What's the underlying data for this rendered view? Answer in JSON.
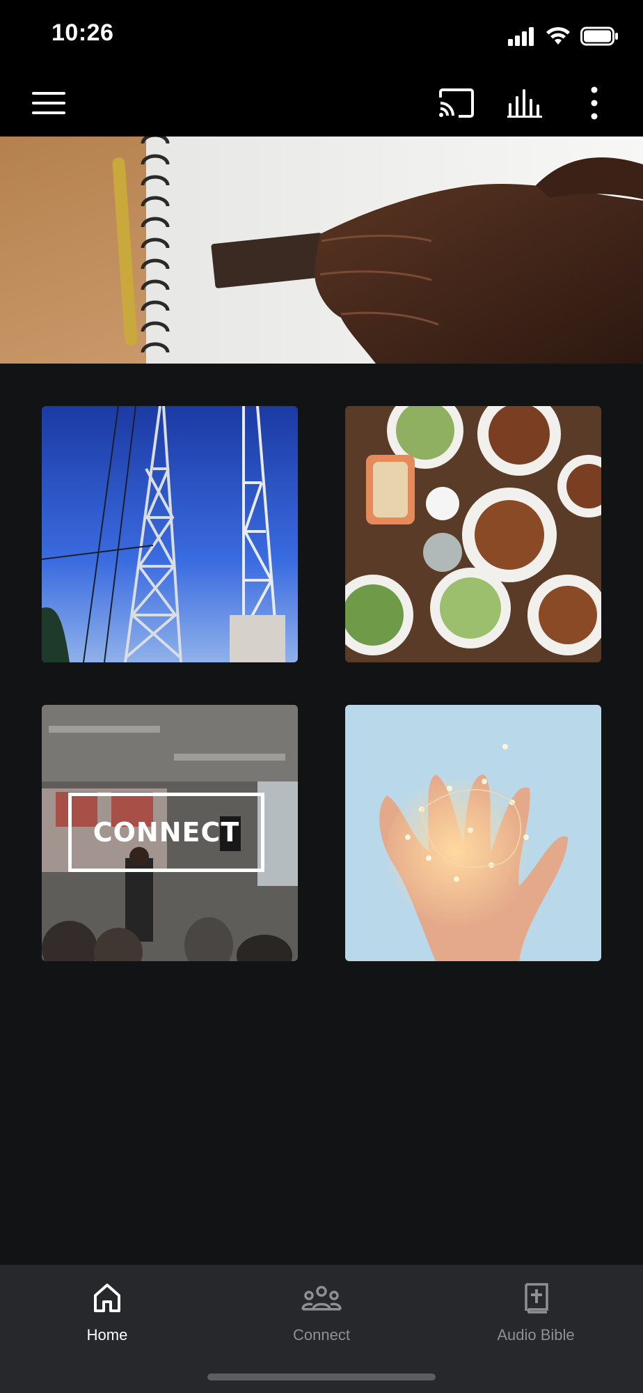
{
  "status_bar": {
    "time": "10:26",
    "icons": [
      "signal-icon",
      "wifi-icon",
      "battery-icon"
    ]
  },
  "app_bar": {
    "icons": [
      "hamburger-menu-icon",
      "cast-icon",
      "equalizer-icon",
      "more-vertical-icon"
    ]
  },
  "hero": {
    "image": "hand on notebook with ruler"
  },
  "tiles": [
    {
      "image": "radio towers against blue sky"
    },
    {
      "image": "table of plated food from above"
    },
    {
      "image": "speaker at church event",
      "label": "CONNECT"
    },
    {
      "image": "hands holding string lights"
    }
  ],
  "bottom_nav": {
    "items": [
      {
        "label": "Home",
        "icon": "home-icon",
        "active": true
      },
      {
        "label": "Connect",
        "icon": "group-icon",
        "active": false
      },
      {
        "label": "Audio Bible",
        "icon": "bible-icon",
        "active": false
      }
    ]
  },
  "colors": {
    "background": "#121315",
    "top_bar": "#000000",
    "bottom_nav": "#26282b",
    "nav_active": "#ffffff",
    "nav_inactive": "#8e9094"
  }
}
